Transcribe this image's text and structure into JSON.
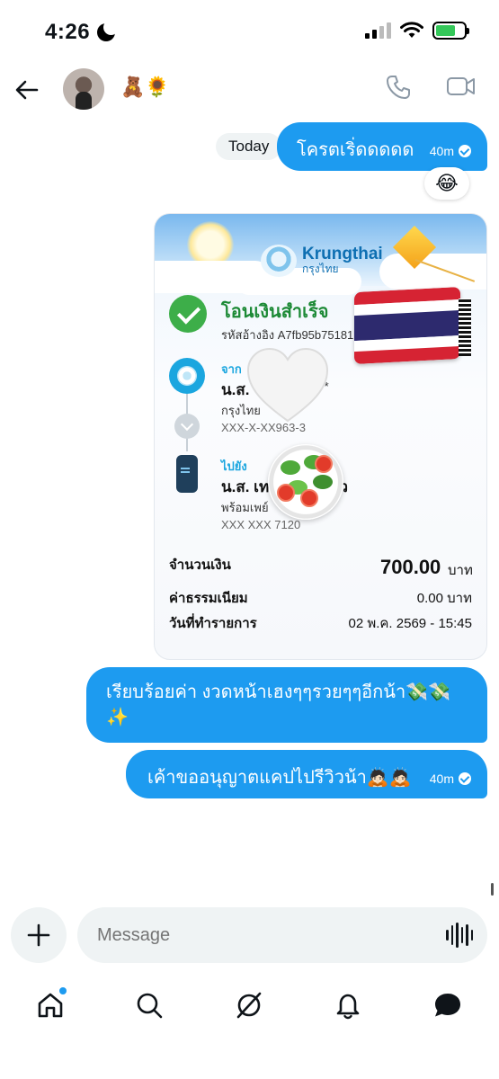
{
  "status_bar": {
    "time": "4:26"
  },
  "header": {
    "contact_name": "🧸🌻"
  },
  "messages": {
    "today_label": "Today",
    "msg1": {
      "text": "โครตเริ่ดดดดด",
      "time": "40m"
    },
    "reaction": "😂",
    "msg3": {
      "text": "เรียบร้อยค่า งวดหน้าเฮงๆๆรวยๆๆอีกน้า💸💸✨"
    },
    "msg4": {
      "text": "เค้าขออนุญาตแคปไปรีวิวน้า🙇🏻🙇🏻",
      "time": "40m"
    }
  },
  "receipt": {
    "bank_name": "Krungthai",
    "bank_name_th": "กรุงไทย",
    "status_title": "โอนเงินสำเร็จ",
    "reference": "รหัสอ้างอิง A7fb95b75181",
    "from_label": "จาก",
    "from_name": "น.ส.",
    "from_name_suffix": "* *",
    "from_bank": "กรุงไทย",
    "from_account": "XXX-X-XX963-3",
    "to_label": "ไปยัง",
    "to_name": "น.ส. เท",
    "to_name_suffix": "ว้ว",
    "to_service": "พร้อมเพย์",
    "to_account": "XXX XXX 7120",
    "amount_label": "จำนวนเงิน",
    "amount_value": "700.00",
    "currency": "บาท",
    "fee_label": "ค่าธรรมเนียม",
    "fee_value": "0.00 บาท",
    "date_label": "วันที่ทำรายการ",
    "date_value": "02 พ.ค. 2569 - 15:45"
  },
  "composer": {
    "placeholder": "Message"
  },
  "nav": {
    "home": "home-icon",
    "search": "search-icon",
    "grok": "grok-icon",
    "notifications": "bell-icon",
    "messages": "messages-icon"
  },
  "colors": {
    "accent": "#1d9bf0",
    "success": "#3dae49",
    "bank_blue": "#1ba6df"
  }
}
